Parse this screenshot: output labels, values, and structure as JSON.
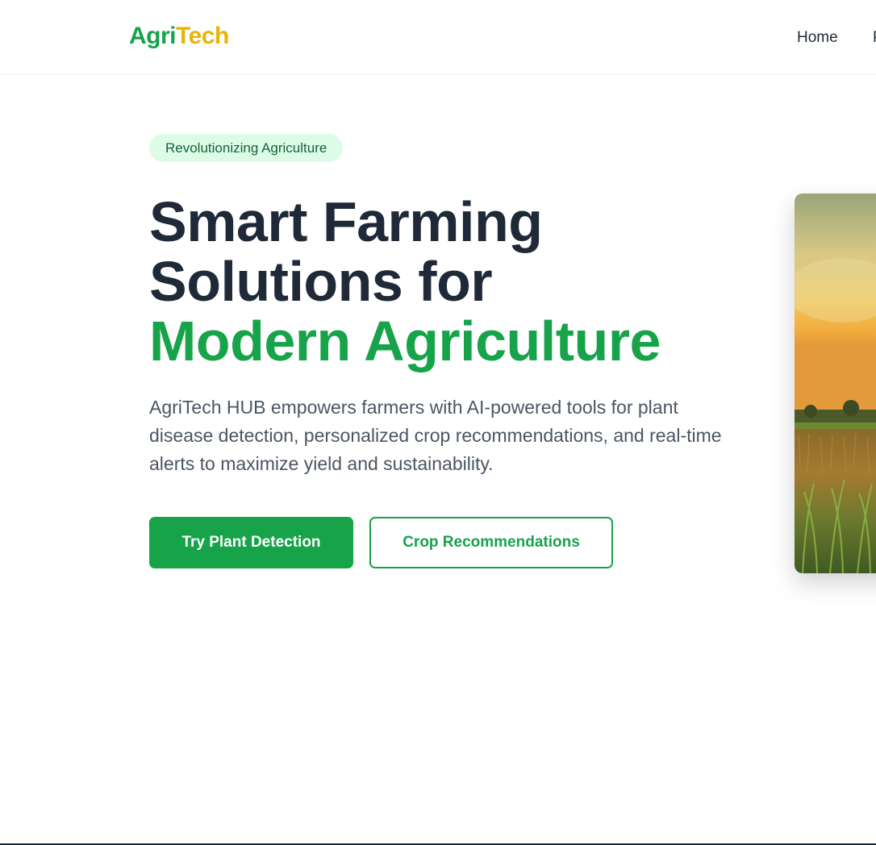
{
  "nav": {
    "logo_part1": "Agri",
    "logo_part2": "Tech",
    "links": [
      {
        "label": "Home"
      },
      {
        "label": "P"
      }
    ]
  },
  "hero": {
    "badge": "Revolutionizing Agriculture",
    "headline_line1": "Smart Farming",
    "headline_line2": "Solutions for",
    "headline_accent": "Modern Agriculture",
    "description": "AgriTech HUB empowers farmers with AI-powered tools for plant disease detection, personalized crop recommendations, and real-time alerts to maximize yield and sustainability.",
    "primary_button": "Try Plant Detection",
    "secondary_button": "Crop Recommendations"
  },
  "colors": {
    "brand_green": "#16a34a",
    "brand_yellow": "#eab308",
    "text_dark": "#1f2937",
    "badge_bg": "#dcfce7"
  }
}
